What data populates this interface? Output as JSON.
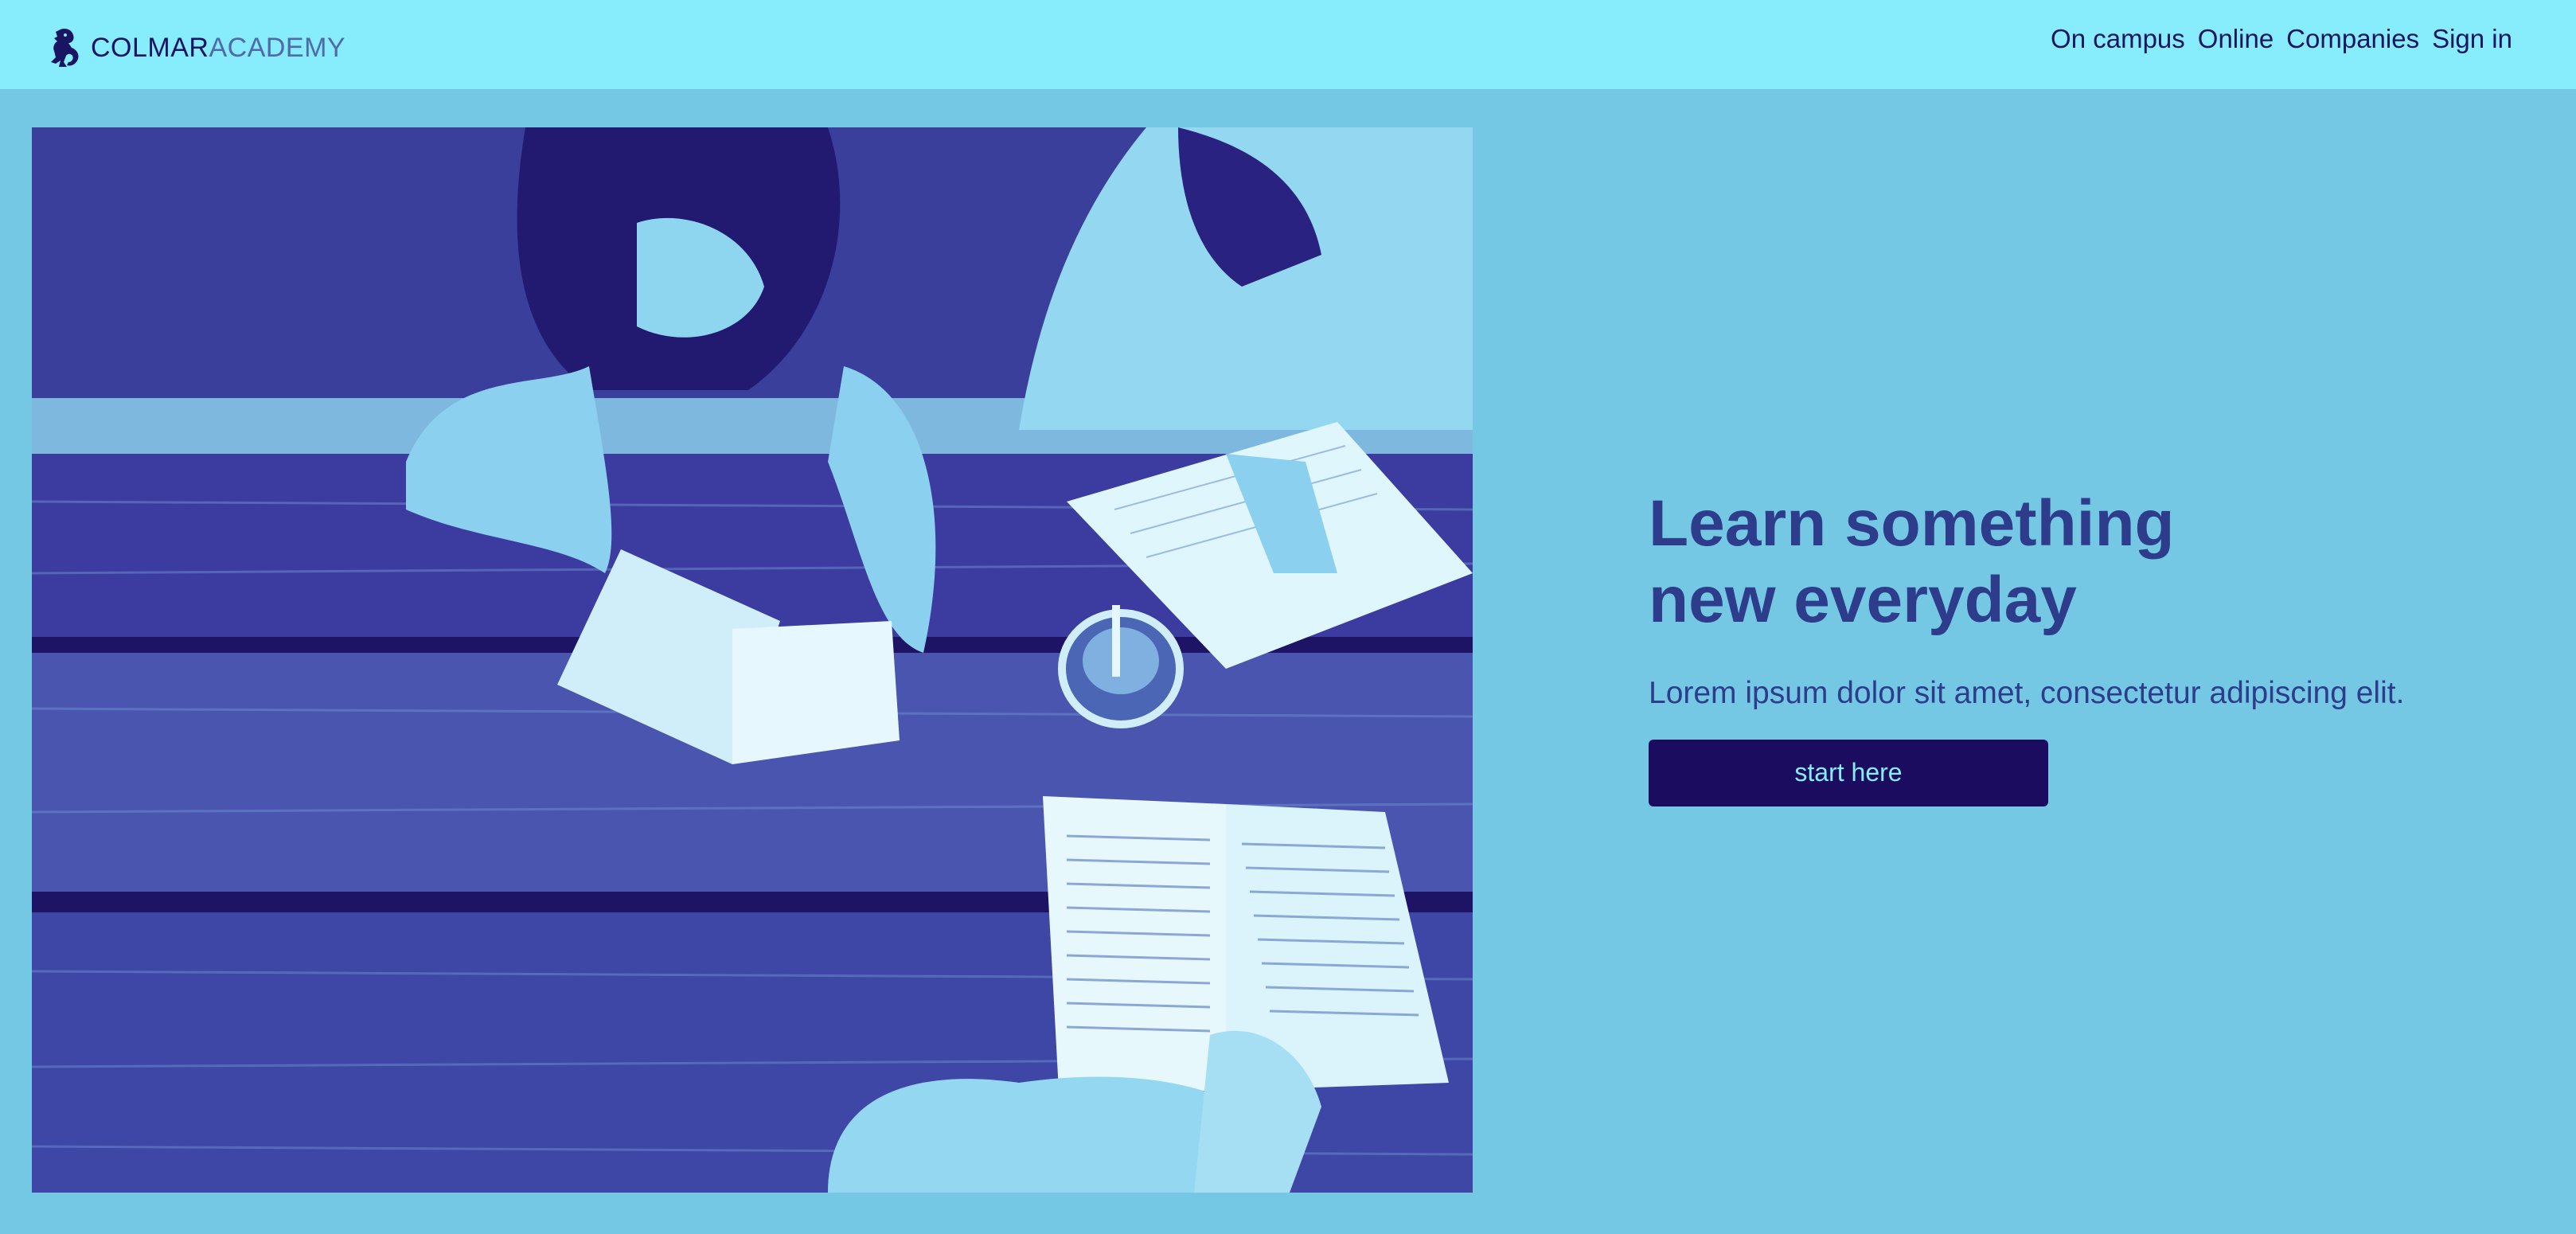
{
  "brand": {
    "name_strong": "COLMAR",
    "name_light": "ACADEMY",
    "icon": "lion-rampant-icon"
  },
  "nav": {
    "items": [
      {
        "label": "On campus"
      },
      {
        "label": "Online"
      },
      {
        "label": "Companies"
      },
      {
        "label": "Sign in"
      }
    ]
  },
  "hero": {
    "headline_line1": "Learn something",
    "headline_line2": "new everyday",
    "subtitle": "Lorem ipsum dolor sit amet, consectetur adipiscing elit.",
    "cta_label": "start here",
    "image_alt": "Students reading books at a wooden table"
  },
  "colors": {
    "topbar": "#87ecfb",
    "page_background": "#75c8e4",
    "headline": "#2e3c8c",
    "nav_text": "#1a1563",
    "cta_background": "#1c0c60",
    "cta_text": "#87ecfb"
  }
}
